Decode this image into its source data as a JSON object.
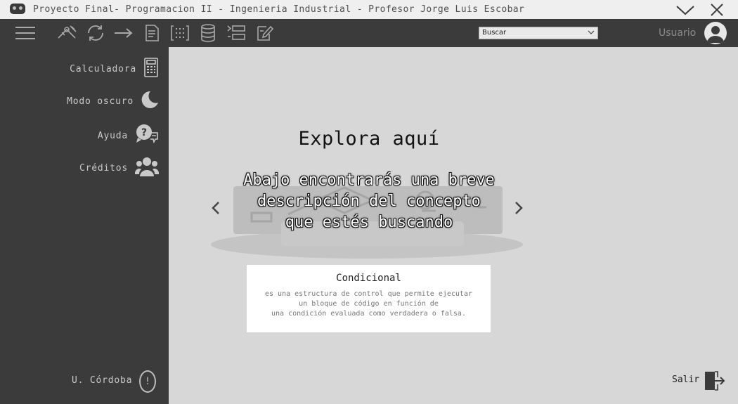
{
  "window": {
    "title": "Proyecto Final- Programacion II - Ingenieria Industrial - Profesor Jorge Luis Escobar"
  },
  "toolbar": {
    "icons": [
      "menu-icon",
      "tool-compass-icon",
      "cycle-icon",
      "arrow-right-icon",
      "document-icon",
      "matrix-icon",
      "database-icon",
      "list-icon",
      "edit-icon"
    ],
    "search": {
      "value": "Buscar"
    },
    "user_label": "Usuario"
  },
  "sidebar": {
    "items": [
      {
        "label": "Calculadora",
        "icon": "calculator-icon"
      },
      {
        "label": "Modo oscuro",
        "icon": "moon-icon"
      },
      {
        "label": "Ayuda",
        "icon": "help-chat-icon"
      },
      {
        "label": "Créditos",
        "icon": "users-group-icon"
      }
    ],
    "footer_label": "U. Córdoba"
  },
  "main": {
    "heading": "Explora aquí",
    "subtitle_lines": [
      "Abajo encontrarás una breve",
      "descripción del concepto",
      "que estés buscando"
    ],
    "card": {
      "title": "Condicional",
      "description": "es una estructura de control que permite ejecutar\nun bloque de código en función de\nuna condición evaluada como verdadera o falsa."
    },
    "exit_label": "Salir"
  },
  "colors": {
    "toolbar_bg": "#3b3b3b",
    "main_bg": "#d7d7d7",
    "card_bg": "#ffffff"
  }
}
